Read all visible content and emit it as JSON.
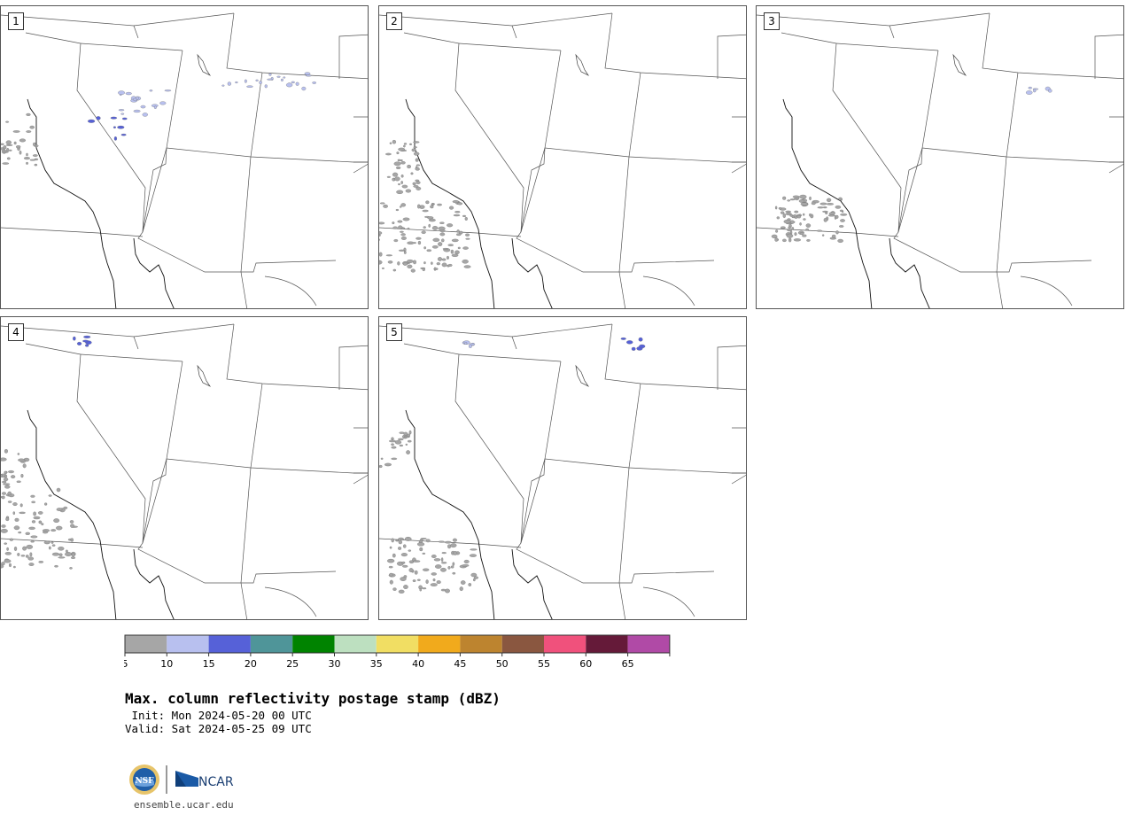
{
  "panels": [
    {
      "id": 1,
      "label": "1"
    },
    {
      "id": 2,
      "label": "2"
    },
    {
      "id": 3,
      "label": "3"
    },
    {
      "id": 4,
      "label": "4"
    },
    {
      "id": 5,
      "label": "5"
    }
  ],
  "colorbar": {
    "ticks": [
      "5",
      "10",
      "15",
      "20",
      "25",
      "30",
      "35",
      "40",
      "45",
      "50",
      "55",
      "60",
      "65"
    ],
    "colors": [
      "#a6a6a6",
      "#b8c0ef",
      "#5661d8",
      "#4f9599",
      "#008300",
      "#bde0c0",
      "#f1de63",
      "#f1aa1c",
      "#bd842f",
      "#8a5740",
      "#f0517c",
      "#651a39",
      "#b04aa6"
    ]
  },
  "title": {
    "main": "Max. column reflectivity postage stamp (dBZ)",
    "init": " Init: Mon 2024-05-20 00 UTC",
    "valid": "Valid: Sat 2024-05-25 09 UTC"
  },
  "footer": {
    "url": "ensemble.ucar.edu",
    "nsf_logo": "nsf-logo",
    "ncar_logo": "NCAR"
  }
}
